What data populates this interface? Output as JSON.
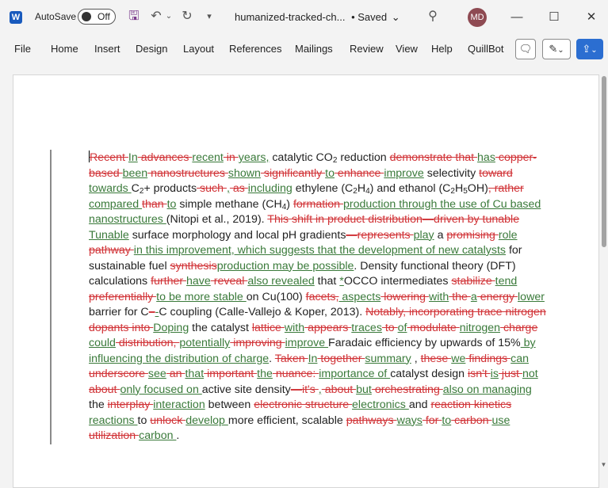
{
  "titlebar": {
    "app_icon": "W",
    "autosave_label": "AutoSave",
    "autosave_state": "Off",
    "doc_title": "humanized-tracked-ch...",
    "save_status": "• Saved",
    "avatar_initials": "MD"
  },
  "ribbon": {
    "tabs": [
      "File",
      "Home",
      "Insert",
      "Design",
      "Layout",
      "References",
      "Mailings",
      "Review",
      "View",
      "Help",
      "QuillBot"
    ]
  },
  "document": {
    "lines": [
      [
        [
          "d",
          "Recent "
        ],
        [
          "i",
          "In"
        ],
        [
          "d",
          " advances "
        ],
        [
          "i",
          "recent"
        ],
        [
          "d",
          " in "
        ],
        [
          "i",
          "years,"
        ],
        [
          "n",
          " catalytic CO"
        ],
        [
          "s",
          "2"
        ],
        [
          "n",
          " reduction "
        ],
        [
          "d",
          "demonstrate that "
        ],
        [
          "i",
          "has"
        ],
        [
          "d",
          " copper-"
        ]
      ],
      [
        [
          "d",
          "based "
        ],
        [
          "i",
          "been"
        ],
        [
          "d",
          " nanostructures "
        ],
        [
          "i",
          "shown"
        ],
        [
          "d",
          " significantly "
        ],
        [
          "i",
          "to"
        ],
        [
          "d",
          " enhance "
        ],
        [
          "i",
          "improve"
        ],
        [
          "n",
          " selectivity "
        ],
        [
          "d",
          "toward"
        ]
      ],
      [
        [
          "i",
          "towards "
        ],
        [
          "n",
          "C"
        ],
        [
          "s",
          "2"
        ],
        [
          "n",
          "+ products"
        ],
        [
          "d",
          " such "
        ],
        [
          "i",
          ","
        ],
        [
          "d",
          " as "
        ],
        [
          "i",
          "including"
        ],
        [
          "n",
          " ethylene (C"
        ],
        [
          "s",
          "2"
        ],
        [
          "n",
          "H"
        ],
        [
          "s",
          "4"
        ],
        [
          "n",
          ") and ethanol (C"
        ],
        [
          "s",
          "2"
        ],
        [
          "n",
          "H"
        ],
        [
          "s",
          "5"
        ],
        [
          "n",
          "OH)"
        ],
        [
          "d",
          ", rather"
        ]
      ],
      [
        [
          "i",
          "compared "
        ],
        [
          "d",
          "than "
        ],
        [
          "i",
          "to"
        ],
        [
          "n",
          " simple methane (CH"
        ],
        [
          "s",
          "4"
        ],
        [
          "n",
          ") "
        ],
        [
          "d",
          "formation "
        ],
        [
          "i",
          "production through the use of Cu based"
        ]
      ],
      [
        [
          "i",
          "nanostructures "
        ],
        [
          "n",
          "(Nitopi et al., 2019). "
        ],
        [
          "d",
          "This shift in product distribution—driven by tunable"
        ]
      ],
      [
        [
          "i",
          "Tunable"
        ],
        [
          "n",
          " surface morphology and local pH gradients"
        ],
        [
          "d",
          "—represents "
        ],
        [
          "i",
          "play"
        ],
        [
          "n",
          " a "
        ],
        [
          "d",
          "promising "
        ],
        [
          "i",
          "role"
        ]
      ],
      [
        [
          "d",
          "pathway "
        ],
        [
          "i",
          "in this improvement, which suggests that the development of new catalysts"
        ],
        [
          "n",
          " for"
        ]
      ],
      [
        [
          "n",
          "sustainable fuel "
        ],
        [
          "d",
          "synthesis"
        ],
        [
          "i",
          "production may be possible"
        ],
        [
          "n",
          ". Density functional theory (DFT)"
        ]
      ],
      [
        [
          "n",
          "calculations "
        ],
        [
          "d",
          "further "
        ],
        [
          "i",
          "have"
        ],
        [
          "d",
          " reveal "
        ],
        [
          "i",
          "also revealed"
        ],
        [
          "n",
          " that "
        ],
        [
          "i",
          "*"
        ],
        [
          "n",
          "OCCO intermediates "
        ],
        [
          "d",
          "stabilize "
        ],
        [
          "i",
          "tend"
        ]
      ],
      [
        [
          "d",
          "preferentially "
        ],
        [
          "i",
          "to be more stable "
        ],
        [
          "n",
          "on Cu(100) "
        ],
        [
          "d",
          "facets,"
        ],
        [
          "i",
          " aspects"
        ],
        [
          "d",
          " lowering "
        ],
        [
          "i",
          "with"
        ],
        [
          "d",
          " the "
        ],
        [
          "i",
          "a"
        ],
        [
          "d",
          " energy "
        ],
        [
          "i",
          "lower"
        ]
      ],
      [
        [
          "n",
          "barrier for C"
        ],
        [
          "d",
          "–"
        ],
        [
          "i",
          "-"
        ],
        [
          "n",
          "C coupling (Calle-Vallejo & Koper, 2013). "
        ],
        [
          "d",
          "Notably, incorporating trace nitrogen"
        ]
      ],
      [
        [
          "d",
          "dopants into "
        ],
        [
          "i",
          "Doping"
        ],
        [
          "n",
          " the catalyst "
        ],
        [
          "d",
          "lattice "
        ],
        [
          "i",
          "with"
        ],
        [
          "d",
          " appears "
        ],
        [
          "i",
          "traces"
        ],
        [
          "d",
          " to "
        ],
        [
          "i",
          "of"
        ],
        [
          "d",
          " modulate "
        ],
        [
          "i",
          "nitrogen"
        ],
        [
          "d",
          " charge"
        ]
      ],
      [
        [
          "i",
          "could"
        ],
        [
          "d",
          " distribution, "
        ],
        [
          "i",
          "potentially"
        ],
        [
          "d",
          " improving "
        ],
        [
          "i",
          "improve "
        ],
        [
          "n",
          "Faradaic efficiency by upwards of 15%"
        ],
        [
          "i",
          " by"
        ]
      ],
      [
        [
          "i",
          "influencing the distribution of charge"
        ],
        [
          "n",
          ". "
        ],
        [
          "d",
          "Taken "
        ],
        [
          "i",
          "In"
        ],
        [
          "d",
          " together "
        ],
        [
          "i",
          "summary"
        ],
        [
          "n",
          " , "
        ],
        [
          "d",
          "these "
        ],
        [
          "i",
          "we"
        ],
        [
          "d",
          " findings "
        ],
        [
          "i",
          "can"
        ]
      ],
      [
        [
          "d",
          "underscore "
        ],
        [
          "i",
          "see"
        ],
        [
          "d",
          " an "
        ],
        [
          "i",
          "that"
        ],
        [
          "d",
          " important "
        ],
        [
          "i",
          "the"
        ],
        [
          "d",
          " nuance: "
        ],
        [
          "i",
          "importance of "
        ],
        [
          "n",
          "catalyst design "
        ],
        [
          "d",
          "isn't "
        ],
        [
          "i",
          "is"
        ],
        [
          "d",
          " just "
        ],
        [
          "i",
          "not"
        ]
      ],
      [
        [
          "d",
          "about "
        ],
        [
          "i",
          "only focused on "
        ],
        [
          "n",
          "active site density"
        ],
        [
          "d",
          "—it's "
        ],
        [
          "i",
          ","
        ],
        [
          "d",
          " about "
        ],
        [
          "i",
          "but"
        ],
        [
          "d",
          " orchestrating "
        ],
        [
          "i",
          "also on managing"
        ]
      ],
      [
        [
          "n",
          "the "
        ],
        [
          "d",
          "interplay "
        ],
        [
          "i",
          "interaction"
        ],
        [
          "n",
          " between "
        ],
        [
          "d",
          "electronic structure "
        ],
        [
          "i",
          "electronics "
        ],
        [
          "n",
          "and "
        ],
        [
          "d",
          "reaction kinetics"
        ]
      ],
      [
        [
          "i",
          "reactions "
        ],
        [
          "n",
          "to "
        ],
        [
          "d",
          "unlock "
        ],
        [
          "i",
          "develop "
        ],
        [
          "n",
          "more efficient, scalable "
        ],
        [
          "d",
          "pathways "
        ],
        [
          "i",
          "ways"
        ],
        [
          "d",
          " for "
        ],
        [
          "i",
          "to"
        ],
        [
          "d",
          " carbon "
        ],
        [
          "i",
          "use"
        ]
      ],
      [
        [
          "d",
          "utilization "
        ],
        [
          "i",
          "carbon "
        ],
        [
          "n",
          "."
        ]
      ]
    ]
  }
}
